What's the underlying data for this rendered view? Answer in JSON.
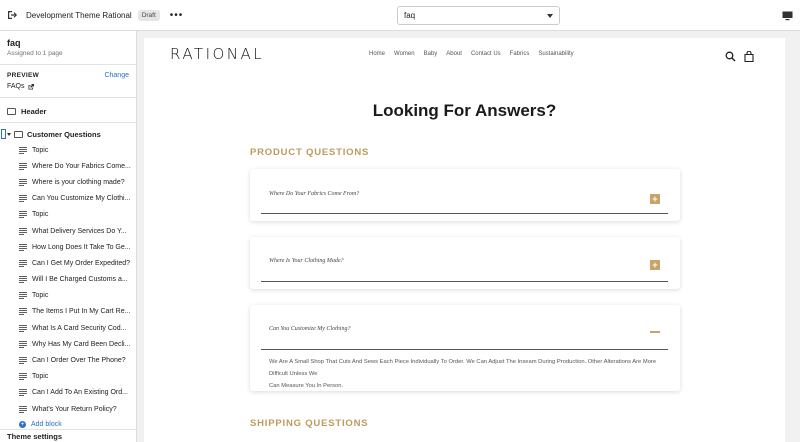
{
  "topbar": {
    "theme_name": "Development Theme Rational",
    "draft_badge": "Draft",
    "more": "•••",
    "page_select_value": "faq"
  },
  "sidebar": {
    "title": "faq",
    "subtitle": "Assigned to 1 page",
    "preview_label": "PREVIEW",
    "change_label": "Change",
    "preview_page": "FAQs",
    "header_section": "Header",
    "customer_section": "Customer Questions",
    "blocks": [
      "Topic",
      "Where Do Your Fabrics Come...",
      "Where is your clothing made?",
      "Can You Customize My Clothi...",
      "Topic",
      "What Delivery Services Do Y...",
      "How Long Does It Take To Ge...",
      "Can I Get My Order Expedited?",
      "Will I Be Charged Customs a...",
      "Topic",
      "The Items I Put In My Cart Re...",
      "What Is A Card Security Cod...",
      "Why Has My Card Been Decli...",
      "Can I Order Over The Phone?",
      "Topic",
      "Can I Add To An Existing Ord...",
      "What's Your Return Policy?"
    ],
    "add_block": "Add block",
    "theme_settings": "Theme settings"
  },
  "site": {
    "logo": "RATIONAL",
    "nav": [
      "Home",
      "Women",
      "Baby",
      "About",
      "Contact Us",
      "Fabrics",
      "Sustainability"
    ],
    "heading": "Looking For Answers?",
    "product_title": "PRODUCT QUESTIONS",
    "q1": "Where Do Your Fabrics Come From?",
    "q2": "Where Is Your Clothing Made?",
    "q3": "Can You Customize My Clothing?",
    "a3_line1": "We Are A Small Shop That Cuts And Sews Each Piece Individually To Order. We Can Adjust The Inseam During Production. Other Alterations Are More Difficult Unless We",
    "a3_line2": "Can Measure You In Person.",
    "shipping_title": "SHIPPING QUESTIONS"
  },
  "colors": {
    "accent_gold": "#bf9a5f",
    "link_blue": "#2c6ecb"
  }
}
